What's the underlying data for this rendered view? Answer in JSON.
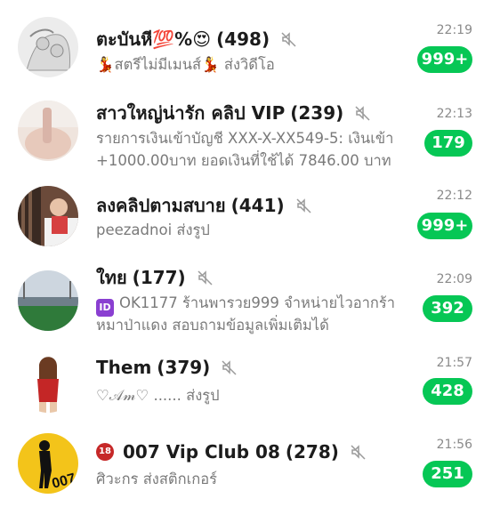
{
  "chats": [
    {
      "name": "ตะบันหี💯%😍",
      "count": "(498)",
      "preview_line1": "💃สตรีไม่มีเมนส์💃 ส่งวิดีโอ",
      "time": "22:19",
      "unread": "999+"
    },
    {
      "name": "สาวใหญ่น่ารัก คลิป VIP",
      "count": "(239)",
      "preview_line1": "รายการเงินเข้าบัญชี XXX-X-XX549-5: เงินเข้า",
      "preview_line2": "+1000.00บาท ยอดเงินที่ใช้ได้ 7846.00 บาท",
      "time": "22:13",
      "unread": "179"
    },
    {
      "name": "ลงคลิปตามสบาย",
      "count": "(441)",
      "preview_line1": "peezadnoi ส่งรูป",
      "time": "22:12",
      "unread": "999+"
    },
    {
      "name": "ใทย",
      "count": "(177)",
      "preview_line1": "OK1177 ร้านพารวย999 จำหน่ายไวอากร้า",
      "preview_icon": "ID",
      "preview_line2": "หมาป่าแดง สอบถามข้อมูลเพิ่มเติมได้",
      "time": "22:09",
      "unread": "392"
    },
    {
      "name": "Them",
      "count": "(379)",
      "preview_line1": "♡𝒜𝓂♡ ...... ส่งรูป",
      "time": "21:57",
      "unread": "428"
    },
    {
      "name": "007 Vip Club 08",
      "name_prefix": "18",
      "count": "(278)",
      "preview_line1": "ศิวะกร ส่งสติกเกอร์",
      "time": "21:56",
      "unread": "251"
    }
  ],
  "colors": {
    "badge": "#06c755",
    "time": "#8a8a8a",
    "preview": "#7a7a7a"
  },
  "icons": {
    "mute": "muted-speaker-icon"
  }
}
